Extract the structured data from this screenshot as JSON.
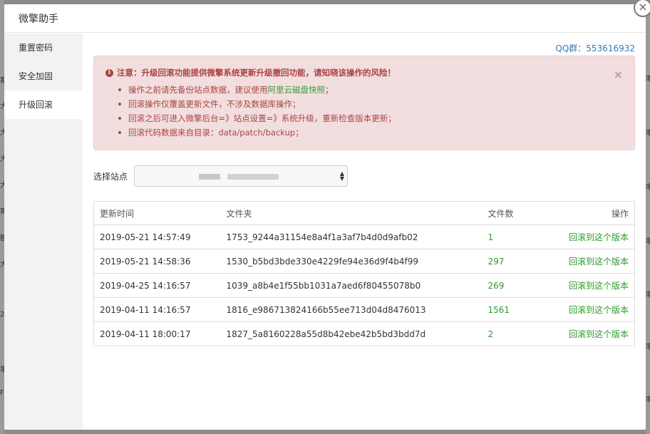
{
  "modal": {
    "title": "微擎助手",
    "close_glyph": "×"
  },
  "sidebar": {
    "items": [
      {
        "label": "重置密码"
      },
      {
        "label": "安全加固"
      },
      {
        "label": "升级回滚"
      }
    ]
  },
  "qq": "QQ群：553616932",
  "alert": {
    "title": "注意：升级回滚功能提供微擎系统更新升级撤回功能，请知晓该操作的风险！",
    "item1_prefix": "操作之前请先备份站点数据，建议使用",
    "item1_link": "阿里云磁盘快照",
    "item1_suffix": "；",
    "item2": "回滚操作仅覆盖更新文件，不涉及数据库操作；",
    "item3": "回滚之后可进入微擎后台=》站点设置=》系统升级，重新检查版本更新；",
    "item4": "回滚代码数据来自目录：data/patch/backup；",
    "close_glyph": "×"
  },
  "site": {
    "label": "选择站点"
  },
  "table": {
    "headers": {
      "time": "更新时间",
      "folder": "文件夹",
      "count": "文件数",
      "action": "操作"
    },
    "rows": [
      {
        "time": "2019-05-21 14:57:49",
        "folder": "1753_9244a31154e8a4f1a3af7b4d0d9afb02",
        "count": "1",
        "action": "回滚到这个版本"
      },
      {
        "time": "2019-05-21 14:58:36",
        "folder": "1530_b5bd3bde330e4229fe94e36d9f4b4f99",
        "count": "297",
        "action": "回滚到这个版本"
      },
      {
        "time": "2019-04-25 14:16:57",
        "folder": "1039_a8b4e1f55bb1031a7aed6f80455078b0",
        "count": "269",
        "action": "回滚到这个版本"
      },
      {
        "time": "2019-04-11 14:16:57",
        "folder": "1816_e986713824166b55ee713d04d8476013",
        "count": "1561",
        "action": "回滚到这个版本"
      },
      {
        "time": "2019-04-11 18:00:17",
        "folder": "1827_5a8160228a55d8b42ebe42b5bd3bdd7d",
        "count": "2",
        "action": "回滚到这个版本"
      }
    ]
  },
  "background": {
    "left_marks": [
      "寨",
      "大",
      "大",
      "大",
      "大",
      "寄",
      "额",
      "大",
      "2",
      "率",
      "F"
    ],
    "right_marks": [
      "率",
      "率",
      "率",
      "率",
      "率",
      "率",
      "率"
    ]
  }
}
